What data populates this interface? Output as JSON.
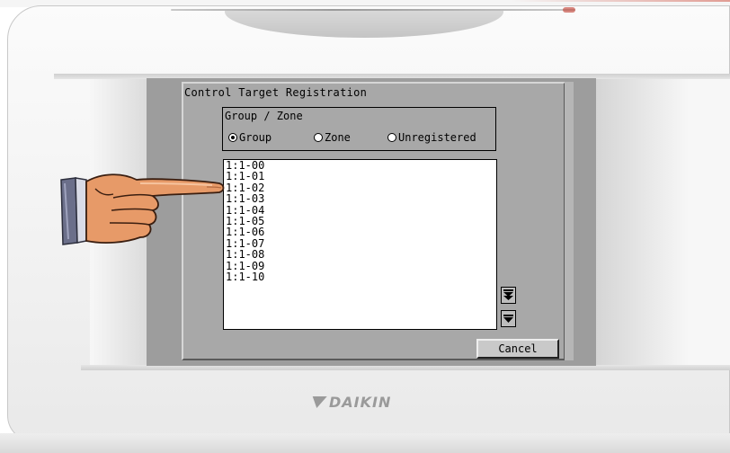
{
  "dialog": {
    "title": "Control Target Registration",
    "group_box_label": "Group / Zone",
    "radio_options": [
      {
        "label": "Group",
        "selected": true
      },
      {
        "label": "Zone",
        "selected": false
      },
      {
        "label": "Unregistered",
        "selected": false
      }
    ],
    "list_items": [
      "1:1-00",
      "1:1-01",
      "1:1-02",
      "1:1-03",
      "1:1-04",
      "1:1-05",
      "1:1-06",
      "1:1-07",
      "1:1-08",
      "1:1-09",
      "1:1-10"
    ],
    "scroll_page_down_icon": "double-chevron-down-icon",
    "scroll_down_icon": "chevron-down-icon",
    "cancel_label": "Cancel"
  },
  "brand": {
    "logo_text": "DAIKIN",
    "logo_color": "#9a9a9a"
  },
  "colors": {
    "screen_bg": "#a8a8a8",
    "list_bg": "#ffffff",
    "hand_skin": "#e79a68",
    "sleeve": "#6b6f8a"
  }
}
